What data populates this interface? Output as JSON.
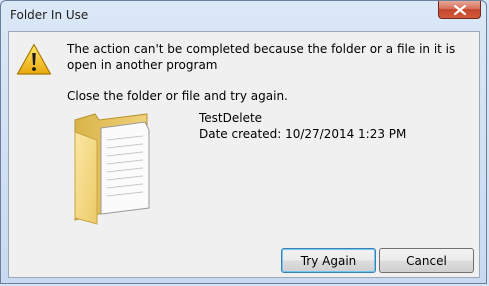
{
  "window": {
    "title": "Folder In Use"
  },
  "message": {
    "primary": "The action can't be completed because the folder or a file in it is open in another program",
    "secondary": "Close the folder or file and try again."
  },
  "file": {
    "name": "TestDelete",
    "date_created": "Date created: 10/27/2014 1:23 PM"
  },
  "buttons": {
    "try_again": "Try Again",
    "cancel": "Cancel"
  },
  "icons": {
    "warning": "warning-icon",
    "folder": "folder-icon",
    "close": "close-icon"
  },
  "colors": {
    "close_button": "#c7462c",
    "folder": "#f4d57a",
    "warning": "#f2c21a"
  }
}
